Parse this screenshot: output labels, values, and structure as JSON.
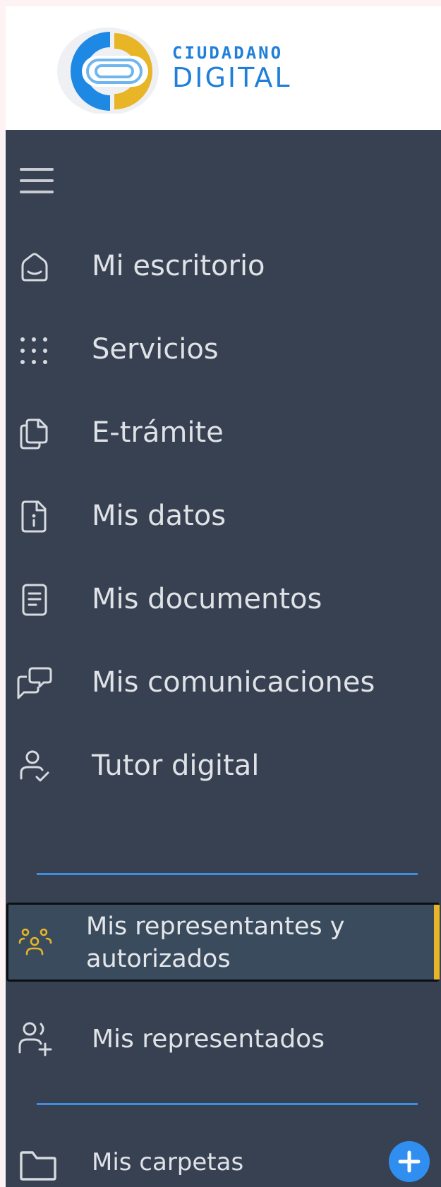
{
  "logo": {
    "line1": "CIUDADANO",
    "line2": "DIGITAL"
  },
  "menu_toggle": {
    "icon": "hamburger-icon"
  },
  "nav": {
    "items": [
      {
        "label": "Mi escritorio",
        "icon": "home-icon"
      },
      {
        "label": "Servicios",
        "icon": "grid-dots-icon"
      },
      {
        "label": "E-trámite",
        "icon": "copy-documents-icon"
      },
      {
        "label": "Mis datos",
        "icon": "info-document-icon"
      },
      {
        "label": "Mis documentos",
        "icon": "document-icon"
      },
      {
        "label": "Mis comunicaciones",
        "icon": "chat-bubbles-icon"
      },
      {
        "label": "Tutor digital",
        "icon": "user-check-icon"
      }
    ],
    "group2": [
      {
        "label": "Mis representantes y autorizados",
        "icon": "users-group-icon",
        "active": true
      },
      {
        "label": "Mis representados",
        "icon": "user-add-icon"
      }
    ],
    "folders": {
      "label": "Mis carpetas",
      "icon": "folder-icon",
      "add_icon": "plus-icon"
    }
  },
  "colors": {
    "sidebar_bg": "#374151",
    "accent_blue": "#3d8fe0",
    "active_indicator": "#e7b526",
    "brand_blue": "#1f7fd9",
    "brand_gold": "#e7b526"
  }
}
